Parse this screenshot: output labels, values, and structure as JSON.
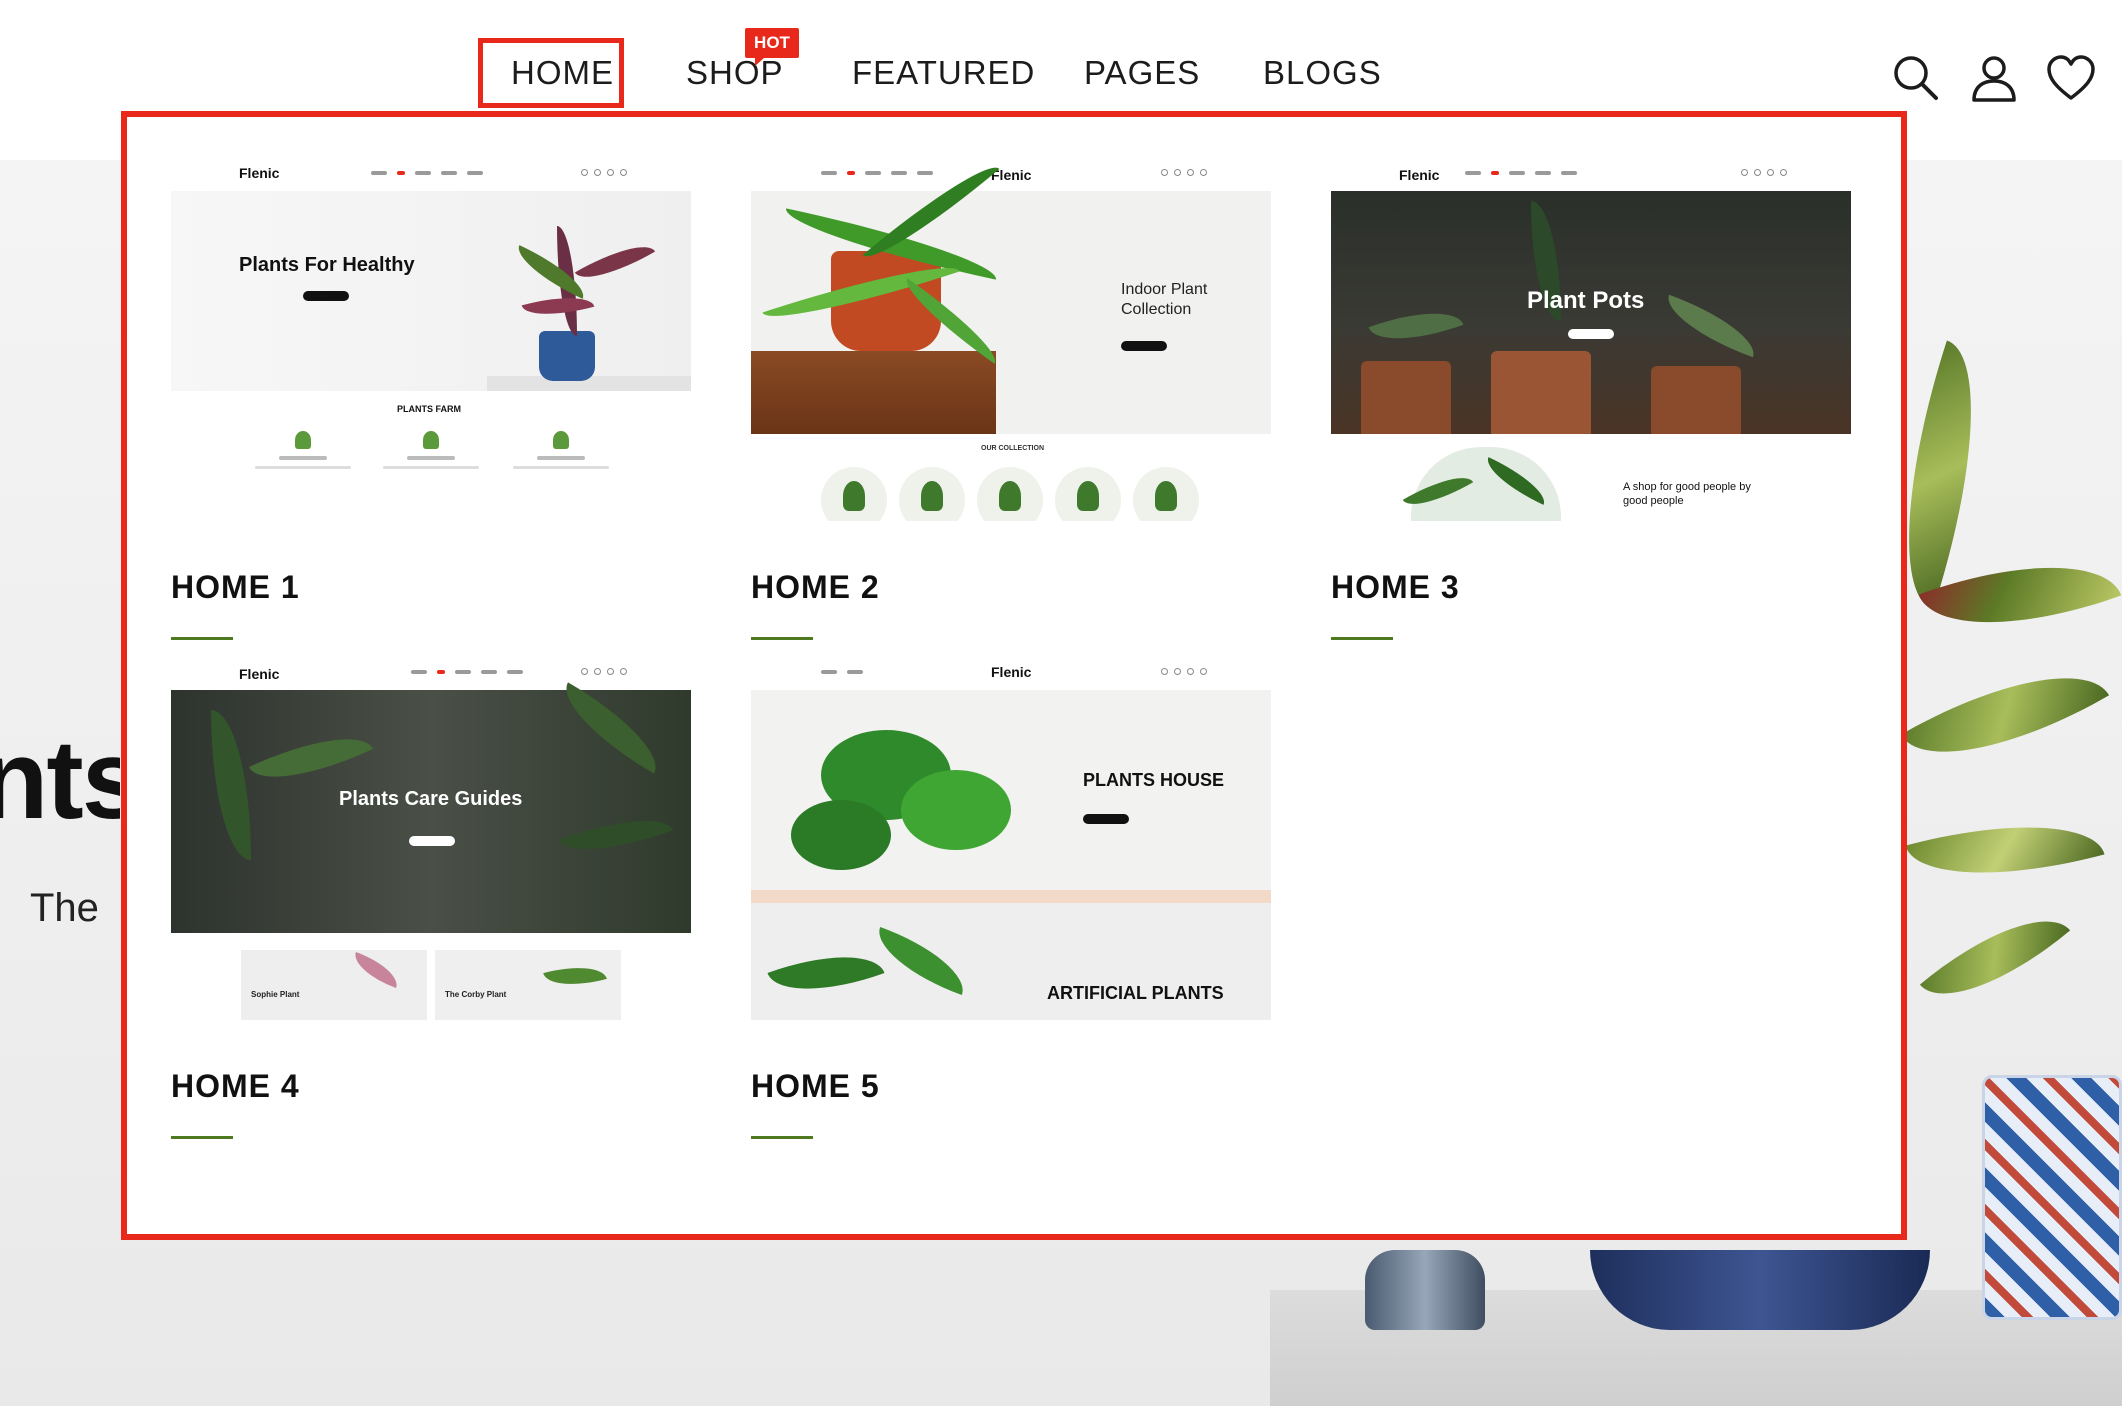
{
  "nav": {
    "items": [
      {
        "id": "home",
        "label": "HOME"
      },
      {
        "id": "shop",
        "label": "SHOP"
      },
      {
        "id": "featured",
        "label": "FEATURED"
      },
      {
        "id": "pages",
        "label": "PAGES"
      },
      {
        "id": "blogs",
        "label": "BLOGS"
      }
    ],
    "shop_badge": "HOT",
    "icons": [
      "search-icon",
      "user-icon",
      "heart-icon"
    ]
  },
  "colors": {
    "accent": "#e8281b",
    "underline": "#4d7a1f",
    "text": "#111111"
  },
  "mega_menu": {
    "cards": [
      {
        "label": "HOME 1",
        "preview": {
          "logo": "Flenic",
          "headline": "Plants For Healthy",
          "section_title": "PLANTS FARM"
        }
      },
      {
        "label": "HOME 2",
        "preview": {
          "logo": "Flenic",
          "headline_line1": "Indoor Plant",
          "headline_line2": "Collection",
          "section_title": "OUR COLLECTION"
        }
      },
      {
        "label": "HOME 3",
        "preview": {
          "logo": "Flenic",
          "headline": "Plant Pots",
          "tagline_line1": "A shop for good people by",
          "tagline_line2": "good people"
        }
      },
      {
        "label": "HOME 4",
        "preview": {
          "logo": "Flenic",
          "headline": "Plants Care Guides",
          "item1": "Sophie Plant",
          "item2": "The Corby Plant"
        }
      },
      {
        "label": "HOME 5",
        "preview": {
          "logo": "Flenic",
          "headline": "PLANTS HOUSE",
          "section_title": "ARTIFICIAL PLANTS"
        }
      }
    ]
  },
  "hero": {
    "title_fragment": "nts",
    "subtitle_fragment": "The"
  }
}
